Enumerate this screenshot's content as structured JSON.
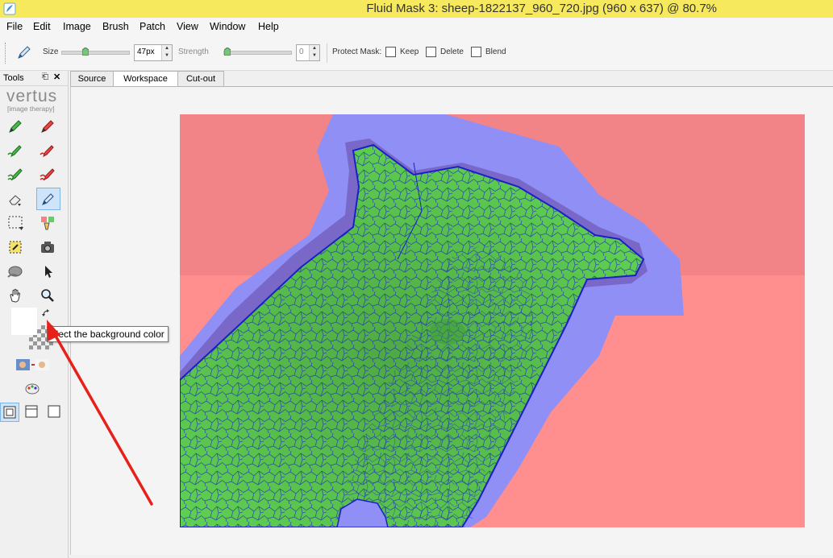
{
  "titlebar": {
    "title": "Fluid Mask 3: sheep-1822137_960_720.jpg (960 x 637) @ 80.7%"
  },
  "menu": [
    "File",
    "Edit",
    "Image",
    "Brush",
    "Patch",
    "View",
    "Window",
    "Help"
  ],
  "toolbar": {
    "size_label": "Size",
    "size_value": "47px",
    "strength_label": "Strength",
    "strength_value": "0",
    "protect_label": "Protect Mask:",
    "keep_label": "Keep",
    "delete_label": "Delete",
    "blend_label": "Blend",
    "size_slider_fraction": 0.38,
    "strength_slider_fraction": 0.0
  },
  "tools_panel": {
    "title": "Tools",
    "brand": "vertus",
    "brand_sub": "[image therapy]"
  },
  "tabs": [
    "Source",
    "Workspace",
    "Cut-out"
  ],
  "active_tab": "Workspace",
  "tooltip": "elect the background color",
  "colors": {
    "titlebar": "#f7e95d",
    "background_mask": "#ff8f8f",
    "blend_zone": "#8f8ff5",
    "foreground_mask": "#5fcf52",
    "edge_lines": "#1e1ec8",
    "arrow": "#e8201a"
  },
  "icons": [
    "pencil-icon",
    "float-icon",
    "close-icon",
    "green-brush-icon",
    "red-brush-icon",
    "eraser-icon",
    "marquee-icon",
    "camera-icon",
    "pointer-icon",
    "hand-icon",
    "zoom-icon",
    "swap-icon"
  ]
}
